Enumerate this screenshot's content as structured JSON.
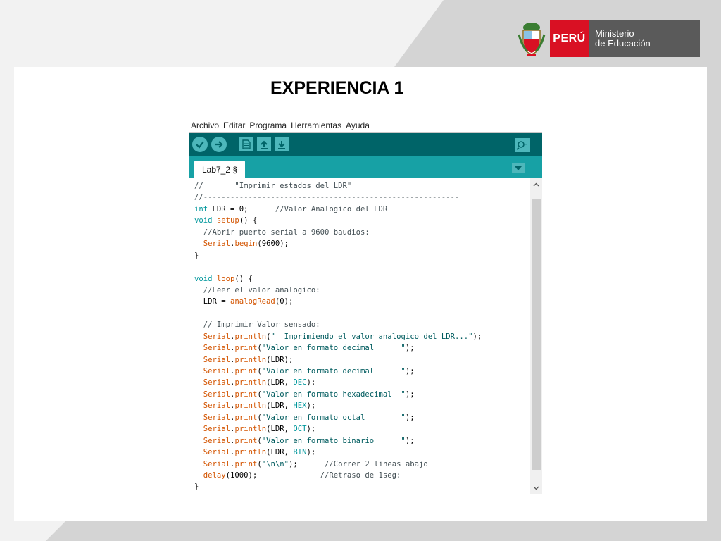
{
  "header": {
    "peru_label": "PERÚ",
    "ministry_line1": "Ministerio",
    "ministry_line2": "de Educación"
  },
  "slide_title": "EXPERIENCIA 1",
  "ide": {
    "menu": [
      "Archivo",
      "Editar",
      "Programa",
      "Herramientas",
      "Ayuda"
    ],
    "tab_label": "Lab7_2 §",
    "colors": {
      "toolbar": "#006468",
      "tabbar": "#17a1a5",
      "button": "#4db7bb"
    },
    "toolbar_icons": [
      "verify-check-icon",
      "upload-arrow-icon",
      "new-file-icon",
      "open-up-arrow-icon",
      "save-down-arrow-icon",
      "serial-monitor-icon"
    ],
    "code_lines": [
      "//       \"Imprimir estados del LDR\"",
      "//---------------------------------------------------------",
      "int LDR = 0;      //Valor Analogico del LDR",
      "void setup() {",
      "  //Abrir puerto serial a 9600 baudios:",
      "  Serial.begin(9600);",
      "}",
      "",
      "void loop() {",
      "  //Leer el valor analogico:",
      "  LDR = analogRead(0);",
      "",
      "  // Imprimir Valor sensado:",
      "  Serial.println(\"  Imprimiendo el valor analogico del LDR...\");",
      "  Serial.print(\"Valor en formato decimal      \");",
      "  Serial.println(LDR);",
      "  Serial.print(\"Valor en formato decimal      \");",
      "  Serial.println(LDR, DEC);",
      "  Serial.print(\"Valor en formato hexadecimal  \");",
      "  Serial.println(LDR, HEX);",
      "  Serial.print(\"Valor en formato octal        \");",
      "  Serial.println(LDR, OCT);",
      "  Serial.print(\"Valor en formato binario      \");",
      "  Serial.println(LDR, BIN);",
      "  Serial.print(\"\\n\\n\");      //Correr 2 lineas abajo",
      "  delay(1000);              //Retraso de 1seg:",
      "}"
    ]
  }
}
